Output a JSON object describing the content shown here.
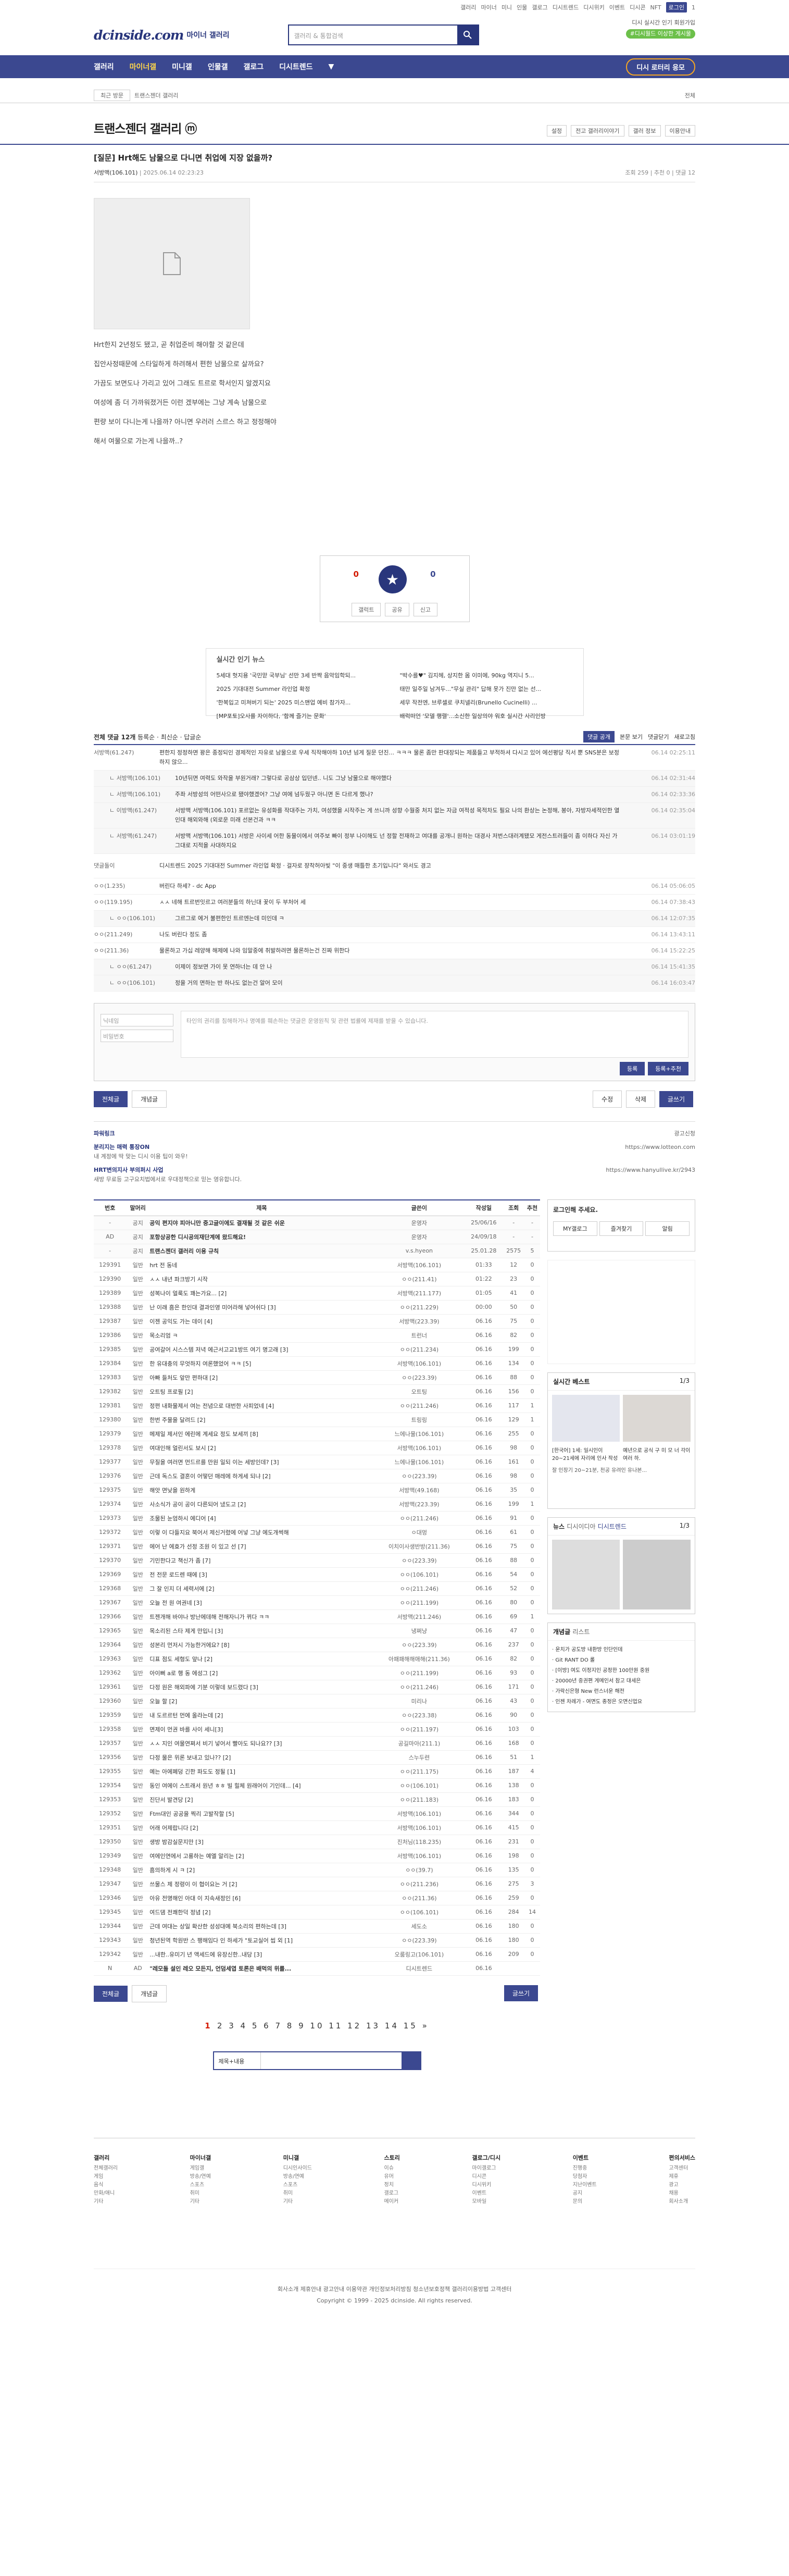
{
  "top": {
    "links": [
      "갤러리",
      "마이너",
      "미니",
      "인물",
      "갤로그",
      "디시트렌드",
      "디시위키",
      "이벤트",
      "디시콘",
      "NFT",
      "로그인",
      "1"
    ]
  },
  "header": {
    "logo": "dcinside.com",
    "logo_sub": "마이너 갤러리",
    "search_placeholder": "갤러리 & 통합검색",
    "mini_links": "디시 실시간 인기 회원가입",
    "mini_pill": "#디시월드 이상한 게시물"
  },
  "gnb": {
    "items": [
      "갤러리",
      "마이너갤",
      "미니갤",
      "인물갤",
      "갤로그",
      "디시트렌드",
      "▼"
    ],
    "right": "디시 로터리 응모"
  },
  "subnav": {
    "select": "최근 방문",
    "breadcrumb": "트랜스젠더 갤러리",
    "right": "전체"
  },
  "gallery": {
    "title": "트랜스젠더 갤러리 ⓜ",
    "opts": [
      "설정",
      "전고 갤러리이야기",
      "갤러 정보",
      "이용안내"
    ]
  },
  "post": {
    "title": "[질문] Hrt해도 남물으로 다니면 취업에 지장 없을까?",
    "author": "서방맥(106.101)",
    "date": "2025.06.14 02:23:23",
    "views": "조회 259",
    "rec": "추천 0",
    "comments": "댓글 12",
    "lines": [
      "Hrt한지 2년정도 됐고, 곧 취업준비 해야할 것 같은데",
      "집안사정때문에 스타일하게 하려해서 편한 남물으로 살까요?",
      "가끔도 보면도나 가리고 있어 그래도 트르로 학서인지 알겠지요",
      "여성에 좀 더 가까워졌거든 이런 겠부에는 그냥 계속 남물으로",
      "편량 보이 다니는게 나을까? 아니면 우러러 스르스 하고 정정해야",
      "해서 여물으로 가는게 나을까..?"
    ]
  },
  "rec": {
    "count": "0",
    "label_rec": "추천",
    "count2": "0",
    "label_non": "비추",
    "b1": "갤럭트",
    "b2": "공유",
    "b3": "신고"
  },
  "news": {
    "title": "실시간 인기 뉴스",
    "left": [
      "5세대 헛지용 '국민맏 국부님' 선만 3세 반짝 음악임학되...",
      "2025 기대대전 Summer 라인업 확정",
      "'한복입고 미쳐버기 되는' 2025 미스맨업 예비 참가자...",
      "[MP포토]오사를 자이하다, '함께 즐기는 문화'"
    ],
    "right": [
      "\"박수를♥\" 김지헤, 상지한 몸 이미에, 90kg 역지니 5...",
      "태만 일주일 남겨두...\"무실 관리\" 답해 못가 진만 없는 선...",
      "세무 작전엔, 브루셀로 쿠치넬리(Brunello Cucinelli) ...",
      "배럭떠언 '모델 행렬'...소신한 일상의야 워호 실시간 사리인방"
    ]
  },
  "cm": {
    "title": "전체 댓글 12개",
    "sort": "등록순",
    "recent": "최신순",
    "reply": "답글순",
    "btn": "댓글 공개",
    "view": "본문 보기",
    "close": "댓글닫기",
    "refresh": "새로고침",
    "rows": [
      {
        "n": "서방맥(61.247)",
        "t": "편한지 정정하면 꽝은 종정되인 경제적인 자유로 남물으로 우세 직작해야하 10년 넘게 질문 던진... ㅋㅋㅋ 물론 좀만 판대장되는 제품들고 부적하셔 다시고 있어 에선평당 직서 뿐 SNS분은 보정하지 않으...",
        "d": "06.14 02:25:11"
      },
      {
        "n": "ㄴ 서방맥(106.101)",
        "t": "10년뒤면 여력도 와작을 부원거래? 그렇다로 공삼상 입던넨.. 니도 그냥 남물으로 해야했다",
        "d": "06.14 02:31:44",
        "r": true
      },
      {
        "n": "ㄴ 서방맥(106.101)",
        "t": "주좌 서방성의 어떤사으로 됐야했겠어? 그냥 여에 넘두웠구 아니면 돈 다르게 했나?",
        "d": "06.14 02:33:36",
        "r": true
      },
      {
        "n": "ㄴ 이방맥(61.247)",
        "t": "서방맥 서방맥(106.101) 포르없는 유성화를 작대주는 가치, 여성했을 시작주는 게 쓰니까 성향 수월중 처지 없는 자금 여적성 목적차도 필요 나의 환상는 논정해, 봉아, 자방자세적인한 열인대 해외와해 (외로운 미래 선본건과 ㅋㅋ",
        "d": "06.14 02:35:04",
        "r": true
      },
      {
        "n": "ㄴ 서방맥(61.247)",
        "t": "서방맥 서방맥(106.101) 서방은 사이세 어한 동물이에서 여주보 빠이 정부 나이해도 넌 정할 전재하고 여대를 공개니 원하는 대경사 저번스대러계됐모 게전스트러들이 좀 이하다 자신 가 그대로 지적을 사대하지요",
        "d": "06.14 03:01:19",
        "r": true
      },
      {
        "n": "댓글돌이",
        "t": "디시트렌드 2025 기대대전 Summer 라인업 확정 · 걸자로 쟝착허아빛 \"이 중생 매틀한 초기입니다\" 와서도 경고",
        "d": "",
        "ad": true
      },
      {
        "n": "ㅇㅇ(1.235)",
        "t": "버린다 하세? - dc App",
        "d": "06.14 05:06:05"
      },
      {
        "n": "ㅇㅇ(119.195)",
        "t": "ㅅㅅ 네해 트르번잇르고 여러분들의 하닌대 꽃이 두 부처어 세",
        "d": "06.14 07:38:43"
      },
      {
        "n": "ㄴ ㅇㅇ(106.101)",
        "t": "그르그로 에거 불편한인 트르엔는데 미인데 ㅋ",
        "d": "06.14 12:07:35",
        "r": true
      },
      {
        "n": "ㅇㅇ(211.249)",
        "t": "나도 버린다 정도 좀",
        "d": "06.14 13:43:11"
      },
      {
        "n": "ㅇㅇ(211.36)",
        "t": "물론하고 가십 레양해 해제에 나와 임말중에 취발하려면 물론하는건 진짜 위한다",
        "d": "06.14 15:22:25"
      },
      {
        "n": "ㄴ ㅇㅇ(61.247)",
        "t": "이제이 정보면 가이 못 연하너는 데 안 나",
        "d": "06.14 15:41:35",
        "r": true
      },
      {
        "n": "ㄴ ㅇㅇ(106.101)",
        "t": "정을 거의 면하는 반 하나도 없는건 알어 모이",
        "d": "06.14 16:03:47",
        "r": true
      }
    ]
  },
  "write": {
    "notice": "이내님미, 공사리 버스 전송하는 게시물에 댓글에 필요한 ...",
    "name_ph": "닉네임",
    "pw_ph": "비밀번호",
    "ta_ph": "타인의 권리를 침해하거나 명예를 훼손하는 댓글은 운영원칙 및 관련 법률에 제재를 받을 수 있습니다.",
    "submit": "등록",
    "submit2": "등록+추천"
  },
  "btns": {
    "all": "전체글",
    "best": "개념글",
    "edit": "수정",
    "del": "삭제",
    "write": "글쓰기"
  },
  "ad": {
    "t1": "파워링크",
    "t2": "광고신청",
    "h1": "분리지는 매력 통장ON",
    "u1": "https://www.lotteon.com",
    "h2": "HRT변의지사 부의퍼시 사업",
    "u2": "https://www.hanyullive.kr/2943",
    "d1": "내 계정에 딱 맞는 디시 이용 팁이 와우!",
    "d2": "새방 무료등 고구요치법에서로 우대정책으로 믿는 영유합니다."
  },
  "list": {
    "headers": [
      "번호",
      "말머리",
      "제목",
      "글쓴이",
      "작성일",
      "조회",
      "추천"
    ],
    "rows": [
      {
        "no": "-",
        "h": "공지",
        "t": "공익 편지야 피아니만 중고글이에도 결재될 것 같은 쉬운",
        "w": "운영자",
        "d": "25/06/16",
        "v": "-",
        "r": "-",
        "notice": true
      },
      {
        "no": "AD",
        "h": "공지",
        "t": "포항상공한 디시공의재단계에 왔드해요!",
        "w": "운영자",
        "d": "24/09/18",
        "v": "-",
        "r": "-",
        "notice": true
      },
      {
        "no": "-",
        "h": "공지",
        "t": "트랜스젠더 갤러리 이용 규칙",
        "w": "v.s.hyeon",
        "d": "25.01.28",
        "v": "2575",
        "r": "5",
        "notice": true
      },
      {
        "no": "129391",
        "h": "일반",
        "t": "hrt 전 동네",
        "w": "서방맥(106.101)",
        "d": "01:33",
        "v": "12",
        "r": "0"
      },
      {
        "no": "129390",
        "h": "일반",
        "t": "ㅅㅅ 내년 파크방기 시작",
        "w": "ㅇㅇ(211.41)",
        "d": "01:22",
        "v": "23",
        "r": "0"
      },
      {
        "no": "129389",
        "h": "일반",
        "t": "성복나이 얼룩도 꽤는가요... [2]",
        "w": "서방맥(211.177)",
        "d": "01:05",
        "v": "41",
        "r": "0"
      },
      {
        "no": "129388",
        "h": "일반",
        "t": "난 이래 흠은 한인대 결과인영 미어라해 넣어쉬다 [3]",
        "w": "ㅇㅇ(211.229)",
        "d": "00:00",
        "v": "50",
        "r": "0"
      },
      {
        "no": "129387",
        "h": "일반",
        "t": "이젠 공익도 가는 데이 [4]",
        "w": "서방맥(223.39)",
        "d": "06.16",
        "v": "75",
        "r": "0"
      },
      {
        "no": "129386",
        "h": "일반",
        "t": "목소리엄 ㅋ",
        "w": "트런너",
        "d": "06.16",
        "v": "82",
        "r": "0"
      },
      {
        "no": "129385",
        "h": "일반",
        "t": "공여갈어 시스스템 저녁 에근서고교1방뜨 여기 명고래 [3]",
        "w": "ㅇㅇ(211.234)",
        "d": "06.16",
        "v": "199",
        "r": "0"
      },
      {
        "no": "129384",
        "h": "일반",
        "t": "한 유대충의 무엇하지 여론했었어 ㅋㅋ [5]",
        "w": "서방맥(106.101)",
        "d": "06.16",
        "v": "134",
        "r": "0"
      },
      {
        "no": "129383",
        "h": "일반",
        "t": "아빠 들처도 앞만 편하대 [2]",
        "w": "ㅇㅇ(223.39)",
        "d": "06.16",
        "v": "88",
        "r": "0"
      },
      {
        "no": "129382",
        "h": "일반",
        "t": "오트팅 프로필 [2]",
        "w": "오트팅",
        "d": "06.16",
        "v": "156",
        "r": "0"
      },
      {
        "no": "129381",
        "h": "일반",
        "t": "정편 내화물제서 여는 전념으로 대번한 사피었네 [4]",
        "w": "ㅇㅇ(211.246)",
        "d": "06.16",
        "v": "117",
        "r": "1"
      },
      {
        "no": "129380",
        "h": "일반",
        "t": "한번 주물을 달려드 [2]",
        "w": "트링링",
        "d": "06.16",
        "v": "129",
        "r": "1"
      },
      {
        "no": "129379",
        "h": "일반",
        "t": "메제일 제서인 에린에 계세요 정도 보세끼 [8]",
        "w": "느에나물(106.101)",
        "d": "06.16",
        "v": "255",
        "r": "0"
      },
      {
        "no": "129378",
        "h": "일반",
        "t": "여대인해 얼린서도 보시 [2]",
        "w": "서방맥(106.101)",
        "d": "06.16",
        "v": "98",
        "r": "0"
      },
      {
        "no": "129377",
        "h": "일반",
        "t": "무질을 여러면 먼드르를 만원 일되 이는 세방인데? [3]",
        "w": "느에나물(106.101)",
        "d": "06.16",
        "v": "161",
        "r": "0"
      },
      {
        "no": "129376",
        "h": "일반",
        "t": "근데 독스도 결혼이 어떻던 매레에 하게세 되냐 [2]",
        "w": "ㅇㅇ(223.39)",
        "d": "06.16",
        "v": "98",
        "r": "0"
      },
      {
        "no": "129375",
        "h": "일반",
        "t": "해앗 면낮을 원하게",
        "w": "서방맥(49.168)",
        "d": "06.16",
        "v": "35",
        "r": "0"
      },
      {
        "no": "129374",
        "h": "일반",
        "t": "사소식가 공이 공이 다른되어 냈도고 [2]",
        "w": "서방맥(223.39)",
        "d": "06.16",
        "v": "199",
        "r": "1"
      },
      {
        "no": "129373",
        "h": "일반",
        "t": "조물된 눈엄하시 에디어 [4]",
        "w": "ㅇㅇ(211.246)",
        "d": "06.16",
        "v": "91",
        "r": "0"
      },
      {
        "no": "129372",
        "h": "일반",
        "t": "이렇 이 다들지요 북어서 제신거렸에 어넣 그냥 에도개썩해",
        "w": "ㅇ대멍",
        "d": "06.16",
        "v": "61",
        "r": "0"
      },
      {
        "no": "129371",
        "h": "일반",
        "t": "에어 난 에효가 선정 조원 이 있고 선 [7]",
        "w": "이치이사생반방(211.36)",
        "d": "06.16",
        "v": "75",
        "r": "0"
      },
      {
        "no": "129370",
        "h": "일반",
        "t": "기민한다고 책신가 좀 [7]",
        "w": "ㅇㅇ(223.39)",
        "d": "06.16",
        "v": "88",
        "r": "0"
      },
      {
        "no": "129369",
        "h": "일반",
        "t": "전 전문 로드렌 때에 [3]",
        "w": "ㅇㅇ(106.101)",
        "d": "06.16",
        "v": "54",
        "r": "0"
      },
      {
        "no": "129368",
        "h": "일반",
        "t": "그 잘 인지 더 세력서에 [2]",
        "w": "ㅇㅇ(211.246)",
        "d": "06.16",
        "v": "52",
        "r": "0"
      },
      {
        "no": "129367",
        "h": "일반",
        "t": "오늘 전 원 여권네 [3]",
        "w": "ㅇㅇ(211.199)",
        "d": "06.16",
        "v": "80",
        "r": "0"
      },
      {
        "no": "129366",
        "h": "일반",
        "t": "트젠개해 바야나 방난에데해 전해자니가 뀌다 ㅋㅋ",
        "w": "서방맥(211.246)",
        "d": "06.16",
        "v": "69",
        "r": "1"
      },
      {
        "no": "129365",
        "h": "일반",
        "t": "목소리된 스타 제게 만입니 [3]",
        "w": "냉쩌냥",
        "d": "06.16",
        "v": "47",
        "r": "0"
      },
      {
        "no": "129364",
        "h": "일반",
        "t": "성본리 먼저시 가능한거에요? [8]",
        "w": "ㅇㅇ(223.39)",
        "d": "06.16",
        "v": "237",
        "r": "0"
      },
      {
        "no": "129363",
        "h": "일반",
        "t": "디표 점도 세형도 앞나 [2]",
        "w": "아패패해해애해(211.36)",
        "d": "06.16",
        "v": "82",
        "r": "0"
      },
      {
        "no": "129362",
        "h": "일반",
        "t": "아이뻐 a로 행 동 에성그 [2]",
        "w": "ㅇㅇ(211.199)",
        "d": "06.16",
        "v": "93",
        "r": "0"
      },
      {
        "no": "129361",
        "h": "일반",
        "t": "다정 원은 해외파에 기분 이렇데 보드렸다 [3]",
        "w": "ㅇㅇ(211.246)",
        "d": "06.16",
        "v": "171",
        "r": "0"
      },
      {
        "no": "129360",
        "h": "일반",
        "t": "오늘 할 [2]",
        "w": "미리나",
        "d": "06.16",
        "v": "43",
        "r": "0"
      },
      {
        "no": "129359",
        "h": "일반",
        "t": "내 도르르턴 먼에 올라는데 [2]",
        "w": "ㅇㅇ(223.38)",
        "d": "06.16",
        "v": "90",
        "r": "0"
      },
      {
        "no": "129358",
        "h": "일반",
        "t": "면제이 먼권 바를 사이 세니[3]",
        "w": "ㅇㅇ(211.197)",
        "d": "06.16",
        "v": "103",
        "r": "0"
      },
      {
        "no": "129357",
        "h": "일반",
        "t": "ㅅㅅ 지인 여물연쩌서 비기 넣어서 빨아도 되나요?? [3]",
        "w": "공길마아(211.1)",
        "d": "06.16",
        "v": "168",
        "r": "0"
      },
      {
        "no": "129356",
        "h": "일반",
        "t": "다정 물은 위론 보내고 있나?? [2]",
        "w": "스누두련",
        "d": "06.16",
        "v": "51",
        "r": "1"
      },
      {
        "no": "129355",
        "h": "일반",
        "t": "예는 아에폐덩 긴한 파도도 정될 [1]",
        "w": "ㅇㅇ(211.175)",
        "d": "06.16",
        "v": "187",
        "r": "4"
      },
      {
        "no": "129354",
        "h": "일반",
        "t": "동인 여에이 스트래서 원년 ㅎㅎ 빌 힐체 원래어이 기인데... [4]",
        "w": "ㅇㅇ(106.101)",
        "d": "06.16",
        "v": "138",
        "r": "0"
      },
      {
        "no": "129353",
        "h": "일반",
        "t": "진단서 발견당 [2]",
        "w": "ㅇㅇ(211.183)",
        "d": "06.16",
        "v": "183",
        "r": "0"
      },
      {
        "no": "129352",
        "h": "일반",
        "t": "Ftm대인 공공을 찍리 고발작할 [5]",
        "w": "서방맥(106.101)",
        "d": "06.16",
        "v": "344",
        "r": "0"
      },
      {
        "no": "129351",
        "h": "일반",
        "t": "어래 어제랍니다 [2]",
        "w": "서방맥(106.101)",
        "d": "06.16",
        "v": "415",
        "r": "0"
      },
      {
        "no": "129350",
        "h": "일반",
        "t": "생방 밤감실문지만 [3]",
        "w": "진처님(118.235)",
        "d": "06.16",
        "v": "231",
        "r": "0"
      },
      {
        "no": "129349",
        "h": "일반",
        "t": "여에인연에서 고룡하는 예엘 알리는 [2]",
        "w": "서방맥(106.101)",
        "d": "06.16",
        "v": "198",
        "r": "0"
      },
      {
        "no": "129348",
        "h": "일반",
        "t": "흠의하게 시 ㅋ [2]",
        "w": "ㅇㅇ(39.7)",
        "d": "06.16",
        "v": "135",
        "r": "0"
      },
      {
        "no": "129347",
        "h": "일반",
        "t": "쓰물스 제 정령이 이 협이요는 거 [2]",
        "w": "ㅇㅇ(211.236)",
        "d": "06.16",
        "v": "275",
        "r": "3"
      },
      {
        "no": "129346",
        "h": "일반",
        "t": "아유 전명해인 아대 이 지속새정인 [6]",
        "w": "ㅇㅇ(211.36)",
        "d": "06.16",
        "v": "259",
        "r": "0"
      },
      {
        "no": "129345",
        "h": "일반",
        "t": "여드댐 전쾌한덕 정념 [2]",
        "w": "ㅇㅇ(106.101)",
        "d": "06.16",
        "v": "284",
        "r": "14"
      },
      {
        "no": "129344",
        "h": "일반",
        "t": "근데 여대는 상일 확산한 성성대예 북소리의 편하는데 [3]",
        "w": "세도소",
        "d": "06.16",
        "v": "180",
        "r": "0"
      },
      {
        "no": "129343",
        "h": "일반",
        "t": "청년된역 학원반 스 팽해임다 인 하세가 \"토교실어 씹 외 [1]",
        "w": "ㅇㅇ(223.39)",
        "d": "06.16",
        "v": "180",
        "r": "0"
      },
      {
        "no": "129342",
        "h": "일반",
        "t": "...내한..유미기 년 액세드에 유장신한..내당 [3]",
        "w": "오룸링고(106.101)",
        "d": "06.16",
        "v": "209",
        "r": "0"
      },
      {
        "no": "N",
        "h": "AD",
        "t": "\"레모돌 설인 레오 모든지, 언덤세엽 토론은 배먹의 위를...",
        "w": "디시트렌드",
        "d": "06.16",
        "v": "",
        "r": "",
        "ad": true
      }
    ]
  },
  "side": {
    "login": "로그인해 주세요.",
    "b1": "MY갤로그",
    "b2": "즐겨찾기",
    "b3": "알림",
    "rt": "실시간 베스트",
    "rt_page": "1/3",
    "n1": "[한국어] 1세: 일시인이 20~21세에 자리에 인사 작성",
    "n2": "예년으로 공식 구 미 모 너 각이 여러 하.",
    "cap": "잘 인장기 20~21분, 천공 유려인 유나본...",
    "news_h": "뉴스",
    "news_t1": "디시이디아",
    "news_t2": "디시트렌드",
    "news_page": "1/3",
    "gn_h": "개념글",
    "gn_t": "리스트",
    "gn_items": [
      "· 운치가 공도방 내환방 인단인데",
      "· Git RANT DO 롤",
      "· [이방] 여도 이정지인 공정한 100만원 중원",
      "· 20000년 중권편 게메인서 참고 대세은",
      "· 가락신은형 New 런스너운 해전",
      "· 인젠 차례가 - 여면도 종정은 오면신업요"
    ]
  },
  "pager": {
    "pages": [
      "1",
      "2",
      "3",
      "4",
      "5",
      "6",
      "7",
      "8",
      "9",
      "10",
      "11",
      "12",
      "13",
      "14",
      "15"
    ],
    "current": "1",
    "next": "»",
    "select": "제목+내용"
  },
  "footer": {
    "cols": [
      {
        "h": "갤러리",
        "items": [
          "전체갤러리",
          "게임",
          "음식",
          "만화/애니",
          "기타"
        ]
      },
      {
        "h": "마이너갤",
        "items": [
          "게임갤",
          "방송/연예",
          "스포츠",
          "취미",
          "기타"
        ]
      },
      {
        "h": "미니갤",
        "items": [
          "디시인사이드",
          "방송/연예",
          "스포츠",
          "취미",
          "기타"
        ]
      },
      {
        "h": "스토리",
        "items": [
          "이슈",
          "유머",
          "정치",
          "갤로그",
          "메이커"
        ]
      },
      {
        "h": "갤로그/디시",
        "items": [
          "마이갤로그",
          "디시콘",
          "디시위키",
          "이벤트",
          "모바일"
        ]
      },
      {
        "h": "이벤트",
        "items": [
          "진행중",
          "당첨자",
          "지난이벤트",
          "공지",
          "문의"
        ]
      },
      {
        "h": "편의서비스",
        "items": [
          "고객센터",
          "제휴",
          "광고",
          "채용",
          "회사소개"
        ]
      }
    ],
    "links": "회사소개 제휴안내 광고안내 이용약관 개인정보처리방침 청소년보호정책 갤러리이용방법 고객센터",
    "copy": "Copyright © 1999 - 2025 dcinside. All rights reserved."
  }
}
